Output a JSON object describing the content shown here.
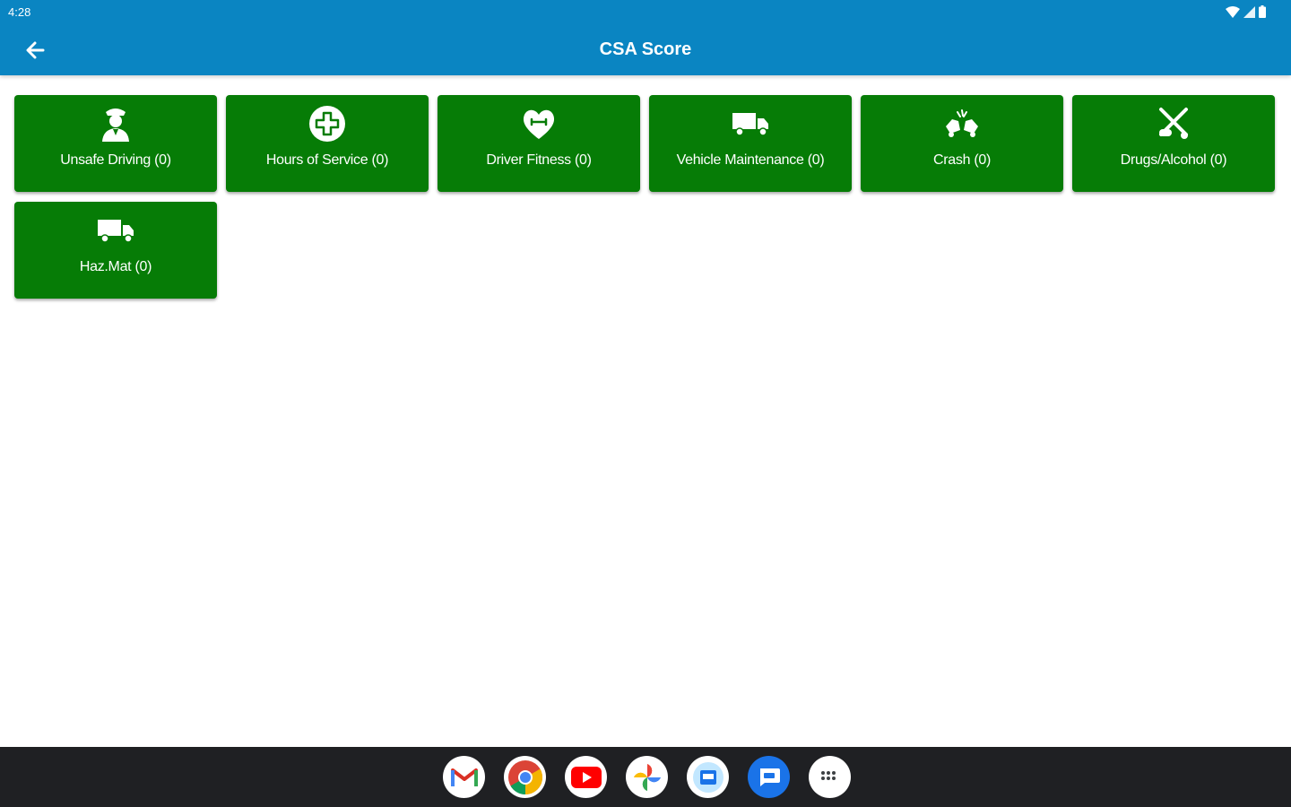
{
  "status_bar": {
    "time": "4:28",
    "icons": [
      "wifi-icon",
      "signal-icon",
      "battery-icon"
    ]
  },
  "app_bar": {
    "title": "CSA Score",
    "back_icon": "arrow-left-icon",
    "color": "#0a85c2"
  },
  "tiles": [
    {
      "label": "Unsafe Driving (0)",
      "icon": "driver-icon"
    },
    {
      "label": "Hours of Service (0)",
      "icon": "medical-cross-icon"
    },
    {
      "label": "Driver Fitness (0)",
      "icon": "heart-fitness-icon"
    },
    {
      "label": "Vehicle Maintenance (0)",
      "icon": "truck-icon"
    },
    {
      "label": "Crash (0)",
      "icon": "crash-icon"
    },
    {
      "label": "Drugs/Alcohol (0)",
      "icon": "drugs-icon"
    },
    {
      "label": "Haz.Mat (0)",
      "icon": "hazmat-truck-icon"
    }
  ],
  "tile_color": "#067c06",
  "dock": {
    "apps": [
      {
        "name": "gmail-icon"
      },
      {
        "name": "chrome-icon"
      },
      {
        "name": "youtube-icon"
      },
      {
        "name": "photos-icon"
      },
      {
        "name": "files-icon"
      },
      {
        "name": "messages-icon"
      },
      {
        "name": "app-drawer-icon"
      }
    ]
  }
}
